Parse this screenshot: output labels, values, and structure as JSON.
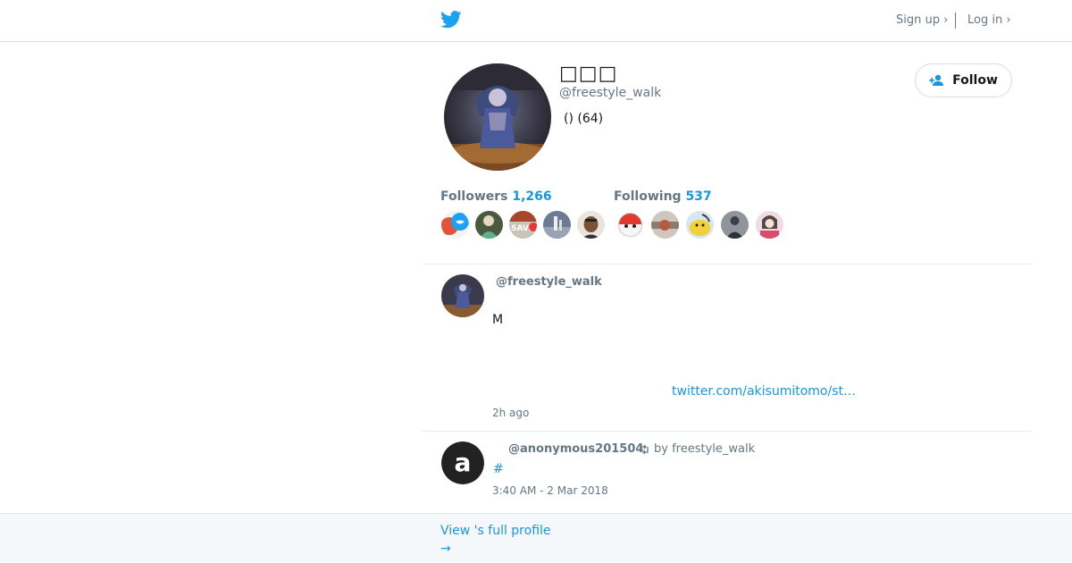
{
  "topbar": {
    "logo": "twitter-bird-icon",
    "signup_label": "Sign up ›",
    "login_label": "Log in ›"
  },
  "profile": {
    "name": "□□□",
    "handle": "@freestyle_walk",
    "bio": "() (64)",
    "follow_label": "Follow"
  },
  "stats": {
    "followers_label": "Followers",
    "followers_count": "1,266",
    "following_label": "Following",
    "following_count": "537"
  },
  "tweets": [
    {
      "handle": "@freestyle_walk",
      "text": "M",
      "link": "twitter.com/akisumitomo/st…",
      "time": "2h ago"
    },
    {
      "handle": "@anonymous201504",
      "retweeted_by": "by freestyle_walk",
      "hashtag": "#",
      "time": "3:40 AM - 2 Mar 2018"
    }
  ],
  "footer": {
    "full_profile": "View 's full profile",
    "arrow": "→"
  },
  "colors": {
    "accent": "#1b95e0",
    "muted": "#657786",
    "text": "#14171a",
    "bird": "#1da1f2"
  }
}
